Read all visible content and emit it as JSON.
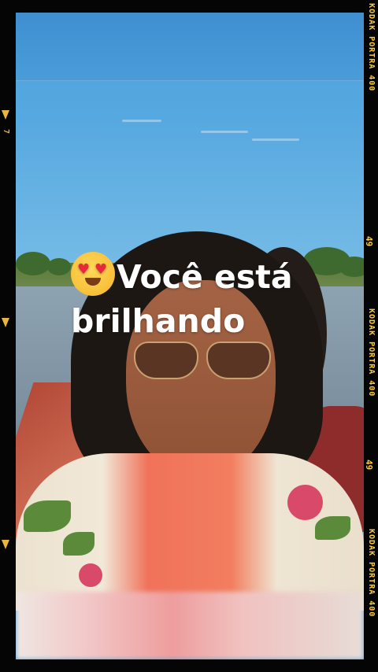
{
  "caption": {
    "emoji_name": "heart-eyes-emoji",
    "line1": "Você está",
    "line2": "brilhando"
  },
  "film_edge": {
    "brand_label": "KODAK PORTRA 400",
    "frame_number": "49",
    "left_number": "7",
    "accent_color": "#ffcc33"
  }
}
